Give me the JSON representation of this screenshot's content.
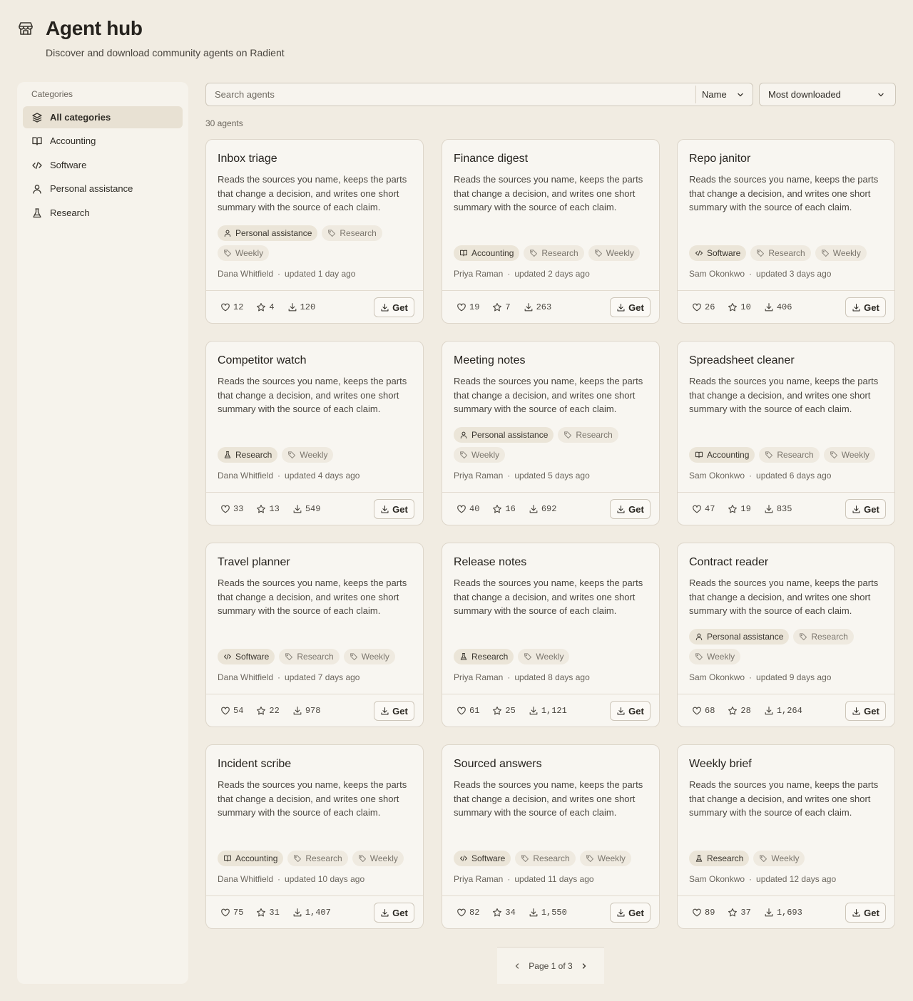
{
  "header": {
    "logo_icon": "store-icon",
    "title": "Agent hub",
    "subtitle": "Discover and download community agents on Radient"
  },
  "sidebar": {
    "heading": "Categories",
    "items": [
      {
        "label": "All categories",
        "icon": "layers-icon",
        "active": true
      },
      {
        "label": "Accounting",
        "icon": "book-open-icon",
        "active": false
      },
      {
        "label": "Software",
        "icon": "code-icon",
        "active": false
      },
      {
        "label": "Personal assistance",
        "icon": "person-icon",
        "active": false
      },
      {
        "label": "Research",
        "icon": "flask-icon",
        "active": false
      }
    ]
  },
  "search": {
    "placeholder": "Search agents",
    "value": "",
    "field_select": "Name",
    "sort_select": "Most downloaded"
  },
  "count_label": "30 agents",
  "action_label": "Get",
  "cards": [
    {
      "name": "Inbox triage",
      "desc": "Reads the sources you name, keeps the parts that change a decision, and writes one short summary with the source of each claim.",
      "category": "Personal assistance",
      "category_icon": "person-icon",
      "keywords": [
        "Research",
        "Weekly"
      ],
      "author": "Dana Whitfield",
      "updated": "updated 1 day ago",
      "likes": "12",
      "stars": "4",
      "downloads": "120"
    },
    {
      "name": "Finance digest",
      "desc": "Reads the sources you name, keeps the parts that change a decision, and writes one short summary with the source of each claim.",
      "category": "Accounting",
      "category_icon": "book-open-icon",
      "keywords": [
        "Research",
        "Weekly"
      ],
      "author": "Priya Raman",
      "updated": "updated 2 days ago",
      "likes": "19",
      "stars": "7",
      "downloads": "263"
    },
    {
      "name": "Repo janitor",
      "desc": "Reads the sources you name, keeps the parts that change a decision, and writes one short summary with the source of each claim.",
      "category": "Software",
      "category_icon": "code-icon",
      "keywords": [
        "Research",
        "Weekly"
      ],
      "author": "Sam Okonkwo",
      "updated": "updated 3 days ago",
      "likes": "26",
      "stars": "10",
      "downloads": "406"
    },
    {
      "name": "Competitor watch",
      "desc": "Reads the sources you name, keeps the parts that change a decision, and writes one short summary with the source of each claim.",
      "category": "Research",
      "category_icon": "flask-icon",
      "keywords": [
        "Weekly"
      ],
      "author": "Dana Whitfield",
      "updated": "updated 4 days ago",
      "likes": "33",
      "stars": "13",
      "downloads": "549"
    },
    {
      "name": "Meeting notes",
      "desc": "Reads the sources you name, keeps the parts that change a decision, and writes one short summary with the source of each claim.",
      "category": "Personal assistance",
      "category_icon": "person-icon",
      "keywords": [
        "Research",
        "Weekly"
      ],
      "author": "Priya Raman",
      "updated": "updated 5 days ago",
      "likes": "40",
      "stars": "16",
      "downloads": "692"
    },
    {
      "name": "Spreadsheet cleaner",
      "desc": "Reads the sources you name, keeps the parts that change a decision, and writes one short summary with the source of each claim.",
      "category": "Accounting",
      "category_icon": "book-open-icon",
      "keywords": [
        "Research",
        "Weekly"
      ],
      "author": "Sam Okonkwo",
      "updated": "updated 6 days ago",
      "likes": "47",
      "stars": "19",
      "downloads": "835"
    },
    {
      "name": "Travel planner",
      "desc": "Reads the sources you name, keeps the parts that change a decision, and writes one short summary with the source of each claim.",
      "category": "Software",
      "category_icon": "code-icon",
      "keywords": [
        "Research",
        "Weekly"
      ],
      "author": "Dana Whitfield",
      "updated": "updated 7 days ago",
      "likes": "54",
      "stars": "22",
      "downloads": "978"
    },
    {
      "name": "Release notes",
      "desc": "Reads the sources you name, keeps the parts that change a decision, and writes one short summary with the source of each claim.",
      "category": "Research",
      "category_icon": "flask-icon",
      "keywords": [
        "Weekly"
      ],
      "author": "Priya Raman",
      "updated": "updated 8 days ago",
      "likes": "61",
      "stars": "25",
      "downloads": "1,121"
    },
    {
      "name": "Contract reader",
      "desc": "Reads the sources you name, keeps the parts that change a decision, and writes one short summary with the source of each claim.",
      "category": "Personal assistance",
      "category_icon": "person-icon",
      "keywords": [
        "Research",
        "Weekly"
      ],
      "author": "Sam Okonkwo",
      "updated": "updated 9 days ago",
      "likes": "68",
      "stars": "28",
      "downloads": "1,264"
    },
    {
      "name": "Incident scribe",
      "desc": "Reads the sources you name, keeps the parts that change a decision, and writes one short summary with the source of each claim.",
      "category": "Accounting",
      "category_icon": "book-open-icon",
      "keywords": [
        "Research",
        "Weekly"
      ],
      "author": "Dana Whitfield",
      "updated": "updated 10 days ago",
      "likes": "75",
      "stars": "31",
      "downloads": "1,407"
    },
    {
      "name": "Sourced answers",
      "desc": "Reads the sources you name, keeps the parts that change a decision, and writes one short summary with the source of each claim.",
      "category": "Software",
      "category_icon": "code-icon",
      "keywords": [
        "Research",
        "Weekly"
      ],
      "author": "Priya Raman",
      "updated": "updated 11 days ago",
      "likes": "82",
      "stars": "34",
      "downloads": "1,550"
    },
    {
      "name": "Weekly brief",
      "desc": "Reads the sources you name, keeps the parts that change a decision, and writes one short summary with the source of each claim.",
      "category": "Research",
      "category_icon": "flask-icon",
      "keywords": [
        "Weekly"
      ],
      "author": "Sam Okonkwo",
      "updated": "updated 12 days ago",
      "likes": "89",
      "stars": "37",
      "downloads": "1,693"
    }
  ],
  "pagination": {
    "label": "Page 1 of 3"
  },
  "colors": {
    "background": "#f1ece2",
    "surface": "#f8f6f1",
    "active": "#e8e1d3",
    "text": "#2b2822",
    "muted": "#6b665d"
  }
}
